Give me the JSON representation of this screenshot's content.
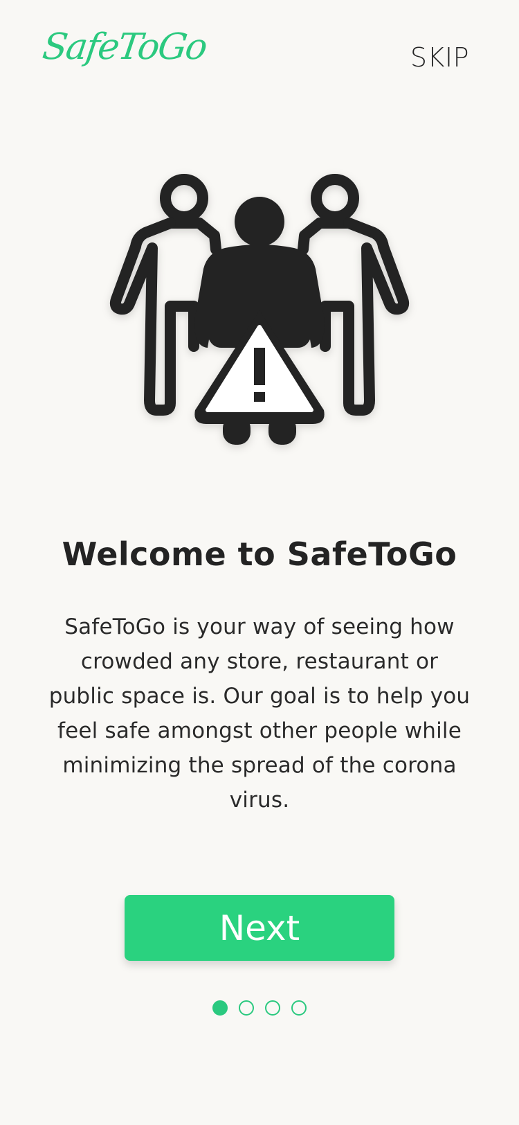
{
  "header": {
    "logo_text": "SafeToGo",
    "skip_label": "SKIP"
  },
  "illustration": {
    "icon": "crowd-warning-icon"
  },
  "content": {
    "title": "Welcome to SafeToGo",
    "description": "SafeToGo is your way of seeing how crowded any store, restaurant or public space is. Our goal is to help you feel safe amongst other people while minimizing the spread of the corona virus."
  },
  "actions": {
    "next_label": "Next"
  },
  "pagination": {
    "total_pages": 4,
    "current_page": 1
  },
  "colors": {
    "accent": "#2ad27f",
    "text": "#232323",
    "background": "#f9f8f5"
  }
}
